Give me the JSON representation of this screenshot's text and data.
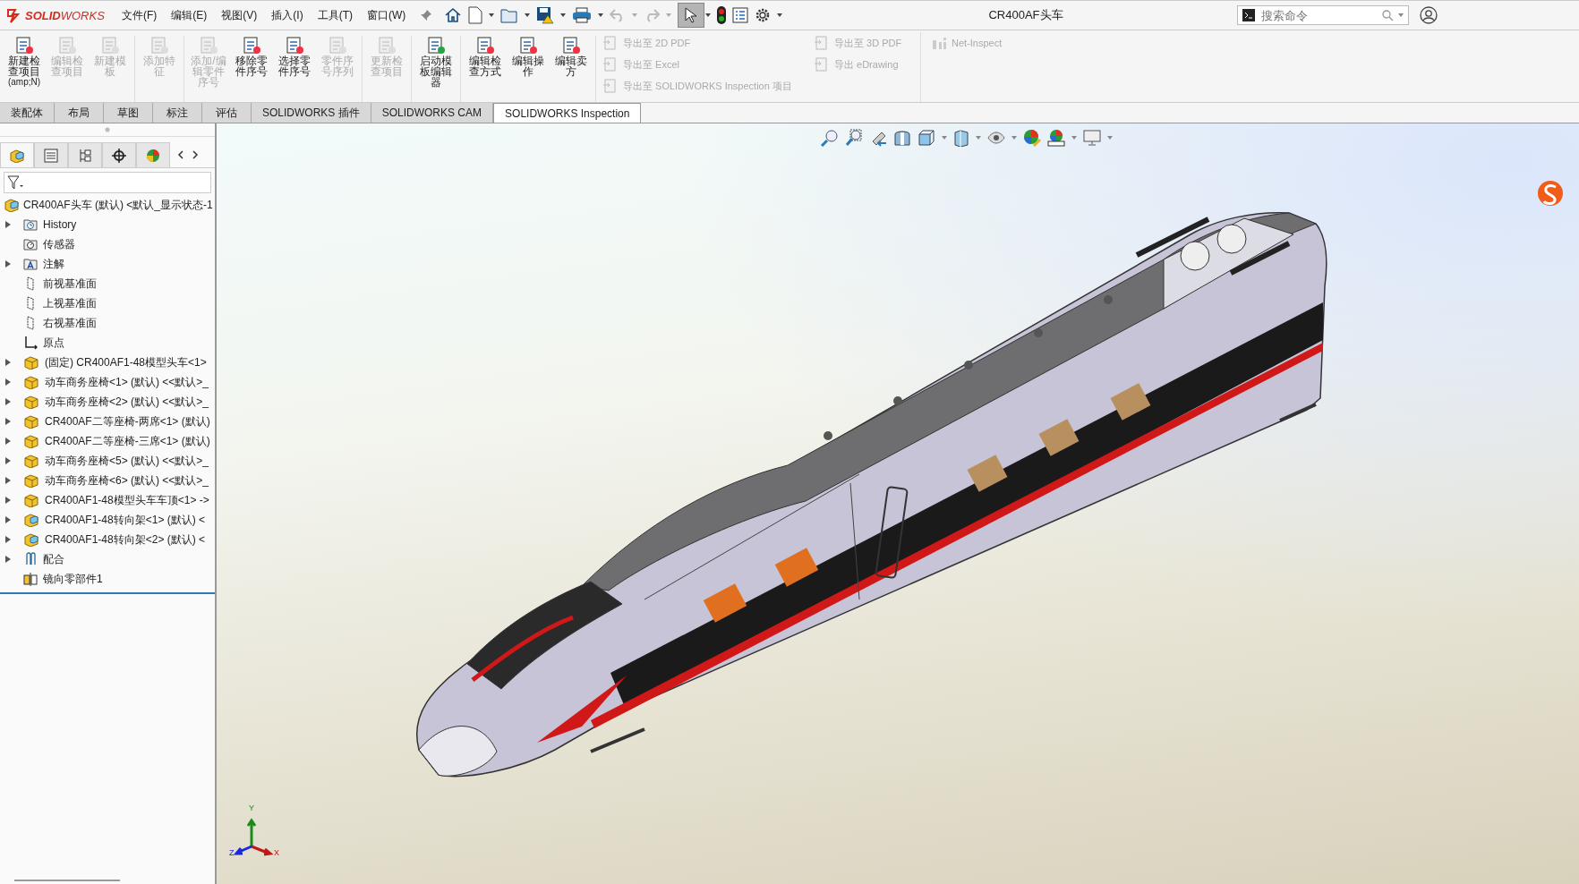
{
  "window": {
    "title": "CR400AF头车"
  },
  "logo": {
    "text": "**SOLID**WORKS"
  },
  "menu": [
    {
      "label": "文件(F)"
    },
    {
      "label": "编辑(E)"
    },
    {
      "label": "视图(V)"
    },
    {
      "label": "插入(I)"
    },
    {
      "label": "工具(T)"
    },
    {
      "label": "窗口(W)"
    }
  ],
  "search": {
    "placeholder": "搜索命令"
  },
  "ribbon": {
    "groups": [
      {
        "buttons": [
          {
            "label": "新建检查项目",
            "shortcut": "(amp;N)",
            "disabled": false
          },
          {
            "label": "编辑检查项目",
            "disabled": true
          },
          {
            "label": "新建模板",
            "disabled": true
          }
        ]
      },
      {
        "buttons": [
          {
            "label": "添加特征",
            "disabled": true
          }
        ]
      },
      {
        "buttons": [
          {
            "label": "添加/编辑零件序号",
            "disabled": true
          },
          {
            "label": "移除零件序号",
            "disabled": false
          },
          {
            "label": "选择零件序号",
            "disabled": false
          },
          {
            "label": "零件序号序列",
            "disabled": true
          }
        ]
      },
      {
        "buttons": [
          {
            "label": "更新检查项目",
            "disabled": true
          }
        ]
      },
      {
        "buttons": [
          {
            "label": "启动模板编辑器",
            "disabled": false
          }
        ]
      },
      {
        "buttons": [
          {
            "label": "编辑检查方式",
            "disabled": false
          },
          {
            "label": "编辑操作",
            "disabled": false
          },
          {
            "label": "编辑卖方",
            "disabled": false
          }
        ]
      }
    ],
    "exports": [
      {
        "label": "导出至 2D PDF",
        "disabled": true
      },
      {
        "label": "导出至 Excel",
        "disabled": true
      },
      {
        "label": "导出至 SOLIDWORKS Inspection 项目",
        "disabled": true
      },
      {
        "label": "导出至 3D PDF",
        "disabled": true
      },
      {
        "label": "导出 eDrawing",
        "disabled": true
      }
    ],
    "net_inspect": {
      "label": "Net-Inspect",
      "disabled": true
    }
  },
  "tabs": [
    {
      "label": "装配体",
      "selected": false
    },
    {
      "label": "布局",
      "selected": false
    },
    {
      "label": "草图",
      "selected": false
    },
    {
      "label": "标注",
      "selected": false
    },
    {
      "label": "评估",
      "selected": false
    },
    {
      "label": "SOLIDWORKS 插件",
      "selected": false
    },
    {
      "label": "SOLIDWORKS CAM",
      "selected": false
    },
    {
      "label": "SOLIDWORKS Inspection",
      "selected": true
    }
  ],
  "tree": {
    "label": "CR400AF头车 (默认) <默认_显示状态-1",
    "kind": "assembly",
    "children": [
      {
        "label": "History",
        "kind": "history",
        "expandable": true
      },
      {
        "label": "传感器",
        "kind": "sensor",
        "expandable": false
      },
      {
        "label": "注解",
        "kind": "annotation",
        "expandable": true
      },
      {
        "label": "前视基准面",
        "kind": "plane",
        "expandable": false
      },
      {
        "label": "上视基准面",
        "kind": "plane",
        "expandable": false
      },
      {
        "label": "右视基准面",
        "kind": "plane",
        "expandable": false
      },
      {
        "label": "原点",
        "kind": "origin",
        "expandable": false
      },
      {
        "label": "(固定) CR400AF1-48模型头车<1>",
        "kind": "part",
        "expandable": true
      },
      {
        "label": "动车商务座椅<1> (默认) <<默认>_",
        "kind": "part",
        "expandable": true
      },
      {
        "label": "动车商务座椅<2> (默认) <<默认>_",
        "kind": "part",
        "expandable": true
      },
      {
        "label": "CR400AF二等座椅-两席<1> (默认)",
        "kind": "part",
        "expandable": true
      },
      {
        "label": "CR400AF二等座椅-三席<1> (默认)",
        "kind": "part",
        "expandable": true
      },
      {
        "label": "动车商务座椅<5> (默认) <<默认>_",
        "kind": "part",
        "expandable": true
      },
      {
        "label": "动车商务座椅<6> (默认) <<默认>_",
        "kind": "part",
        "expandable": true
      },
      {
        "label": "CR400AF1-48模型头车车顶<1> ->",
        "kind": "part",
        "expandable": true
      },
      {
        "label": "CR400AF1-48转向架<1> (默认) <",
        "kind": "assembly",
        "expandable": true
      },
      {
        "label": "CR400AF1-48转向架<2> (默认) <",
        "kind": "assembly",
        "expandable": true
      },
      {
        "label": "配合",
        "kind": "mates",
        "expandable": true
      },
      {
        "label": "镜向零部件1",
        "kind": "mirror",
        "expandable": false
      }
    ]
  },
  "triad": {
    "x": "X",
    "y": "Y",
    "z": "Z"
  }
}
